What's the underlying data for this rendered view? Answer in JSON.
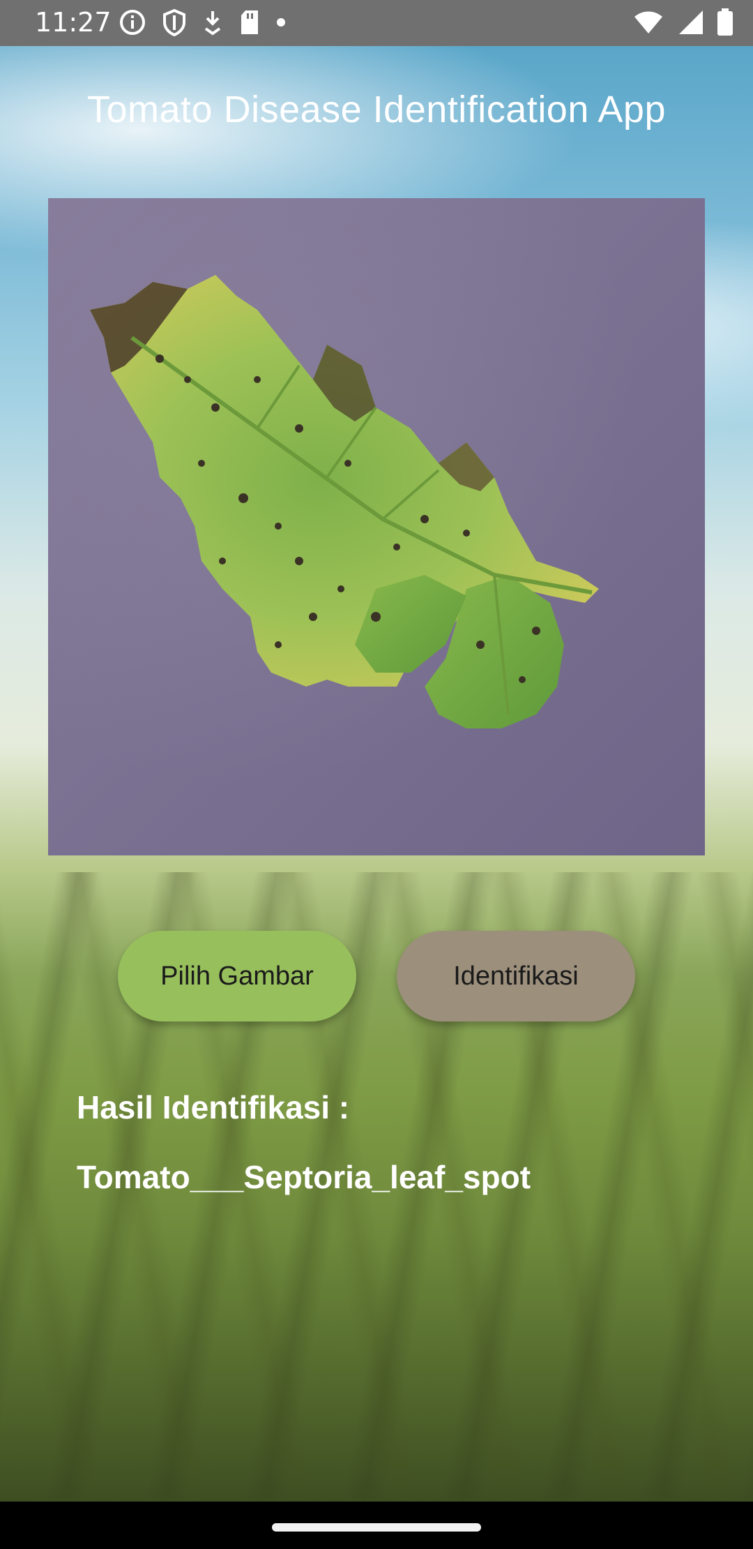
{
  "status_bar": {
    "time": "11:27",
    "left_icons": [
      "info-icon",
      "shield-icon",
      "download-icon",
      "sd-card-icon",
      "dot-icon"
    ],
    "right_icons": [
      "wifi-icon",
      "signal-icon",
      "battery-icon"
    ]
  },
  "app": {
    "title": "Tomato Disease Identification App"
  },
  "image": {
    "subject": "tomato-leaf-photo"
  },
  "buttons": {
    "pick_label": "Pilih Gambar",
    "identify_label": "Identifikasi"
  },
  "result": {
    "label": "Hasil Identifikasi :",
    "value": "Tomato___Septoria_leaf_spot"
  },
  "colors": {
    "pick_button": "#97bf5c",
    "identify_button": "#9c8f7c"
  }
}
